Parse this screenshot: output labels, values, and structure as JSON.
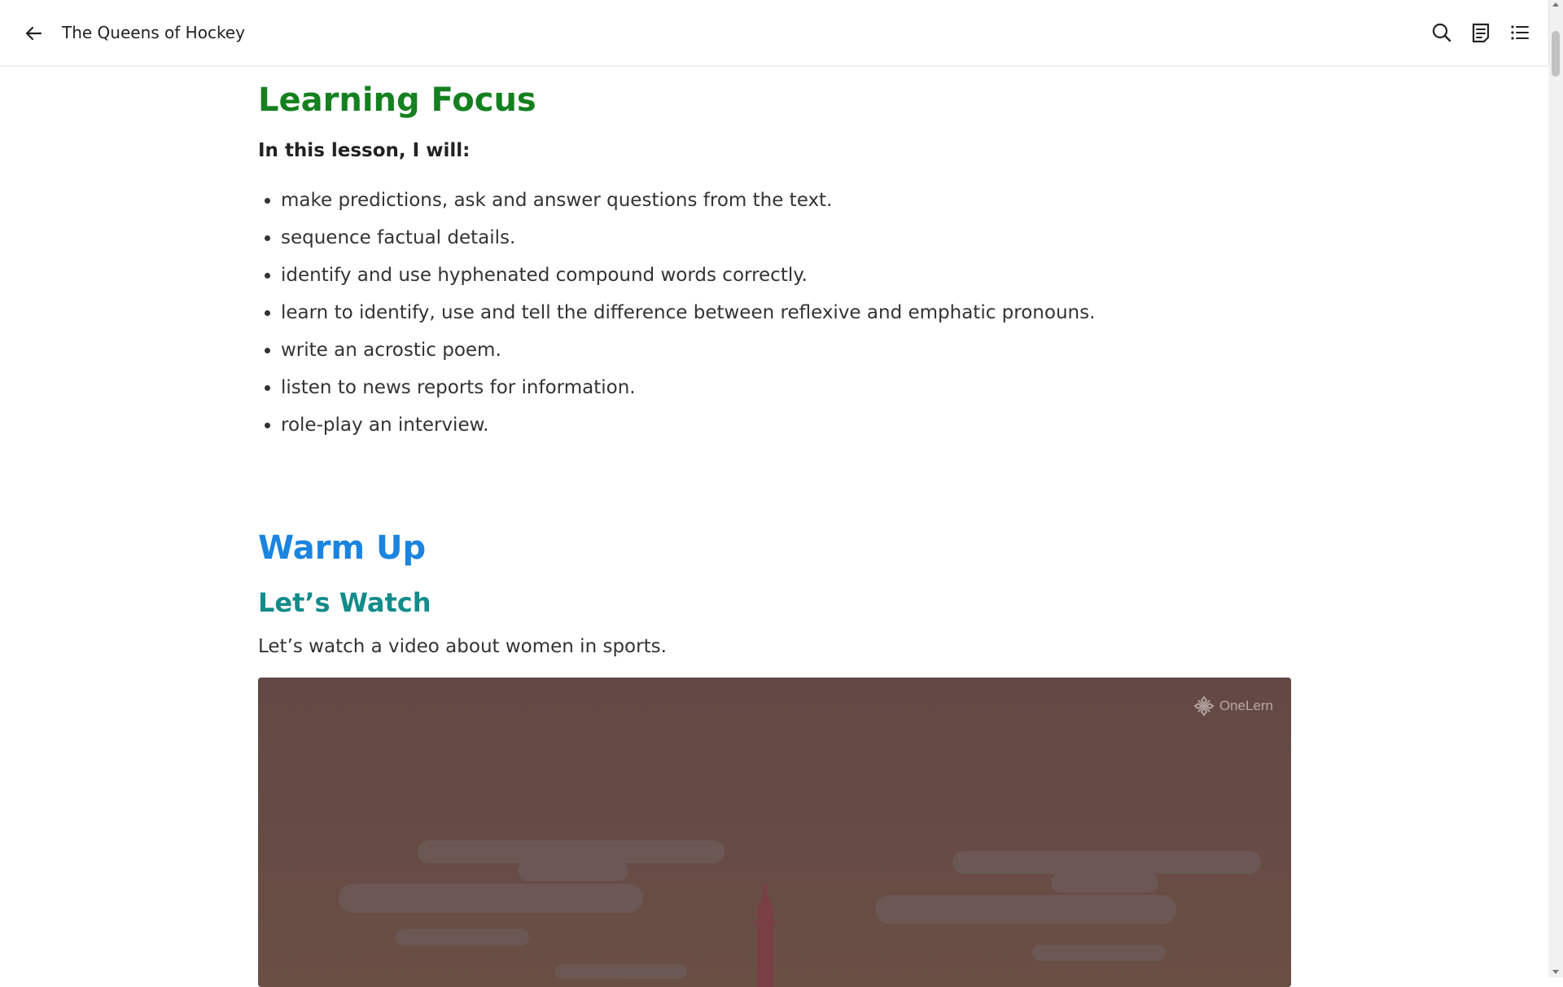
{
  "header": {
    "title": "The Queens of Hockey",
    "icons": {
      "back": "arrow-left-icon",
      "search": "search-icon",
      "notes": "notes-icon",
      "toc": "list-icon"
    }
  },
  "content": {
    "learning_focus": {
      "heading": "Learning Focus",
      "intro": "In this lesson, I will:",
      "items": [
        "make predictions, ask and answer questions from the text.",
        "sequence factual details.",
        "identify and use hyphenated compound words correctly.",
        "learn to identify, use and tell the difference between reflexive and emphatic pronouns.",
        "write an acrostic poem.",
        "listen to news reports for information.",
        "role-play an interview."
      ]
    },
    "warm_up": {
      "heading": "Warm Up",
      "subheading": "Let’s Watch",
      "text": "Let’s watch a video about women in sports."
    },
    "video": {
      "brand": "OneLern"
    }
  },
  "colors": {
    "focus_heading": "#14801f",
    "warm_heading": "#1a84e0",
    "watch_heading": "#128c8a",
    "video_bg": "#634a45"
  }
}
